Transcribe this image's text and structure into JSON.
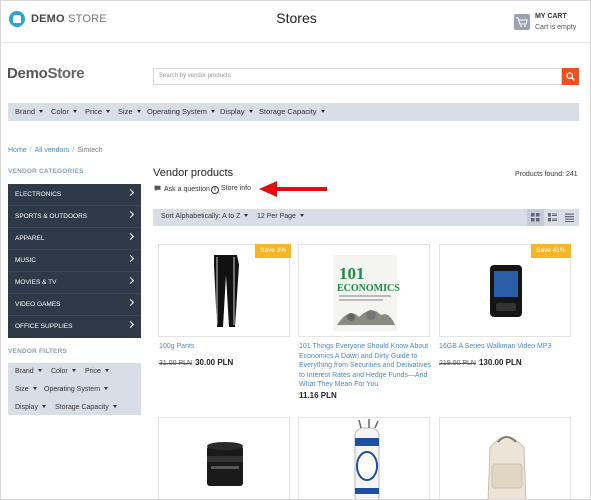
{
  "header": {
    "logo_bold": "DEMO",
    "logo_light": "STORE",
    "title": "Stores",
    "cart_title": "MY CART",
    "cart_status": "Cart is empty"
  },
  "brand": {
    "part1": "Demo",
    "part2": "Store"
  },
  "search": {
    "placeholder": "Search by vendor products"
  },
  "filters": [
    "Brand",
    "Color",
    "Price",
    "Size",
    "Operating System",
    "Display",
    "Storage Capacity"
  ],
  "breadcrumb": [
    "Home",
    "All vendors",
    "Simtech"
  ],
  "sidebar": {
    "categories_heading": "VENDOR CATEGORIES",
    "categories": [
      "ELECTRONICS",
      "SPORTS & OUTDOORS",
      "APPAREL",
      "MUSIC",
      "MOVIES & TV",
      "VIDEO GAMES",
      "OFFICE SUPPLIES"
    ],
    "filters_heading": "VENDOR FILTERS",
    "filters": [
      "Brand",
      "Color",
      "Price",
      "Size",
      "Operating System",
      "Display",
      "Storage Capacity"
    ]
  },
  "main": {
    "title": "Vendor products",
    "products_found": "Products found: 241",
    "ask_question": "Ask a question",
    "store_info": "Store info",
    "sort_label": "Sort Alphabetically: A to Z",
    "per_page": "12 Per Page"
  },
  "products": [
    {
      "name": "100g Pants",
      "old_price": "31.00 PLN",
      "price": "30.00 PLN",
      "badge": "Save 3%"
    },
    {
      "name": "101 Things Everyone Should Know About Economics A Down and Dirty Guide to Everything from Securities and Derivatives to Interest Rates and Hedge Funds—And What They Mean For You",
      "price": "11.16 PLN",
      "book_num": "101",
      "book_word": "ECONOMICS"
    },
    {
      "name": "16GB A Series Walkman Video MP3",
      "old_price": "219.00 PLN",
      "price": "130.00 PLN",
      "badge": "Save 41%"
    }
  ],
  "colors": {
    "accent": "#f04f22",
    "sidebar_bg": "#2e3a48",
    "badge": "#f7b52c",
    "link": "#4a8ac7"
  }
}
